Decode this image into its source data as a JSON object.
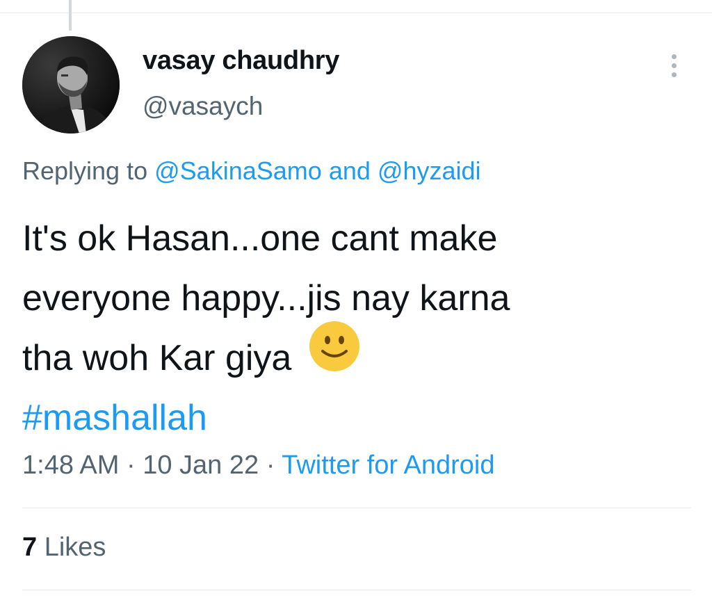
{
  "tweet": {
    "author_name": "vasay chaudhry",
    "author_handle": "@vasaych",
    "replying_prefix": "Replying to",
    "reply_to_1": "@SakinaSamo",
    "reply_joiner": "and",
    "reply_to_2": "@hyzaidi",
    "text_line_1": "It's ok Hasan...one cant make",
    "text_line_2": "everyone happy...jis nay karna",
    "text_line_3": "tha woh Kar giya",
    "emoji": "slightly-smiling-face-icon",
    "hashtag": "#mashallah",
    "time": "1:48 AM",
    "separator": "·",
    "date": "10 Jan 22",
    "source": "Twitter for Android",
    "likes_count": "7",
    "likes_label": "Likes"
  },
  "colors": {
    "link": "#1d9bf0",
    "secondary_text": "#536471",
    "primary_text": "#0f1419",
    "divider": "#e7e9ea"
  }
}
